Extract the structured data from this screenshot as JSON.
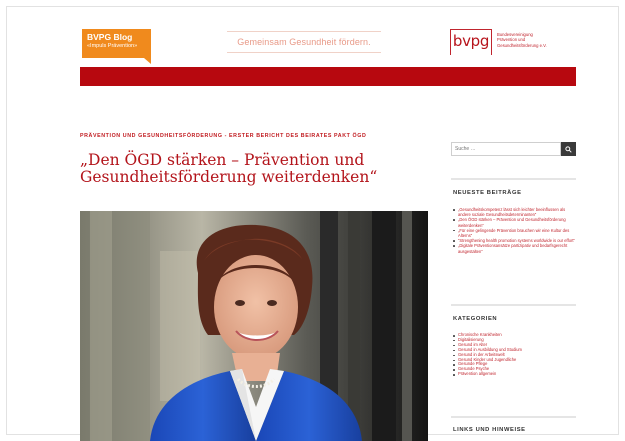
{
  "header": {
    "blog_title": "BVPG Blog",
    "blog_subtitle": "«Impuls Prävention»",
    "slogan": "Gemeinsam Gesundheit fördern.",
    "logo_word": "bvpg",
    "logo_lines": [
      "Bundesvereinigung",
      "Prävention und",
      "Gesundheitsförderung e.V."
    ]
  },
  "colors": {
    "brand_red": "#b7080f",
    "tag_orange": "#f08a1d",
    "link_red": "#c0252e"
  },
  "post": {
    "kicker": "Prävention und Gesundheitsförderung - Erster Bericht des Beirates Pakt ÖGD",
    "title": "„Den ÖGD stärken – Prävention und Gesundheitsförderung weiterdenken“"
  },
  "sidebar": {
    "search": {
      "placeholder": "Suche …",
      "icon": "search-icon"
    },
    "recent": {
      "title": "Neueste Beiträge",
      "items": [
        "„Gesundheitskompetenz lässt sich leichter beeinflussen als andere soziale Gesundheitsdeterminanten“",
        "„Den ÖGD stärken – Prävention und Gesundheitsförderung weiterdenken“",
        "„Für eine gelingende Prävention brauchen wir eine Kultur des Alterns“",
        "“Strengthening health promotion systems worldwide is our effort“",
        "„Digitale Präventionsansätze partizipativ und bedarfsgerecht ausgestalten“"
      ]
    },
    "categories": {
      "title": "Kategorien",
      "items": [
        "Chronische Krankheiten",
        "Digitalisierung",
        "Gesund im Alter",
        "Gesund in Ausbildung und Studium",
        "Gesund in der Arbeitswelt",
        "Gesund Kinder und Jugendliche",
        "Gesunde Pflege",
        "Gesunde Psyche",
        "Prävention allgemein"
      ]
    },
    "links_title": "Links und Hinweise"
  }
}
